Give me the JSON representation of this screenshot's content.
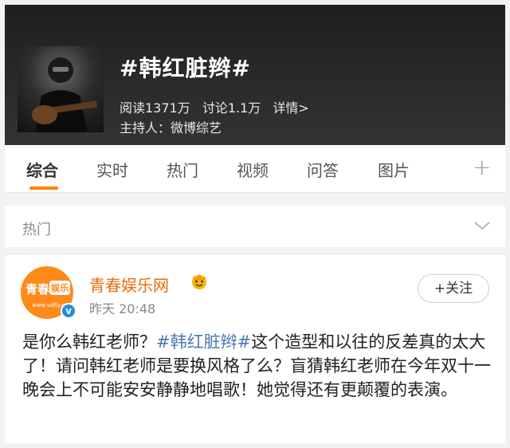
{
  "topic": {
    "title": "#韩红脏辫#",
    "read_label": "阅读1371万",
    "discuss_label": "讨论1.1万",
    "detail_label": "详情>",
    "host_label": "主持人：微博综艺"
  },
  "tabs": [
    {
      "label": "综合",
      "active": true
    },
    {
      "label": "实时"
    },
    {
      "label": "热门"
    },
    {
      "label": "视频"
    },
    {
      "label": "问答"
    },
    {
      "label": "图片"
    }
  ],
  "tab_add_icon": "plus-icon",
  "section": {
    "label": "热门",
    "icon": "chevron-down-icon"
  },
  "post": {
    "avatar_text_left": "青春",
    "avatar_text_right": "娱乐",
    "avatar_url": "www.vdfly.com",
    "author": "青春娱乐网",
    "time": "昨天 20:48",
    "follow_label": "+关注",
    "text_before": "是你么韩红老师？",
    "hashtag": "#韩红脏辫#",
    "text_after": "这个造型和以往的反差真的太大了！请问韩红老师是要换风格了么？盲猜韩红老师在今年双十一晚会上不可能安安静静地唱歌！她觉得还有更颠覆的表演。"
  },
  "colors": {
    "accent_orange": "#ff8200",
    "author_orange": "#e86c10",
    "hashtag_blue": "#4b79b0",
    "verified_blue": "#1e8de6"
  }
}
